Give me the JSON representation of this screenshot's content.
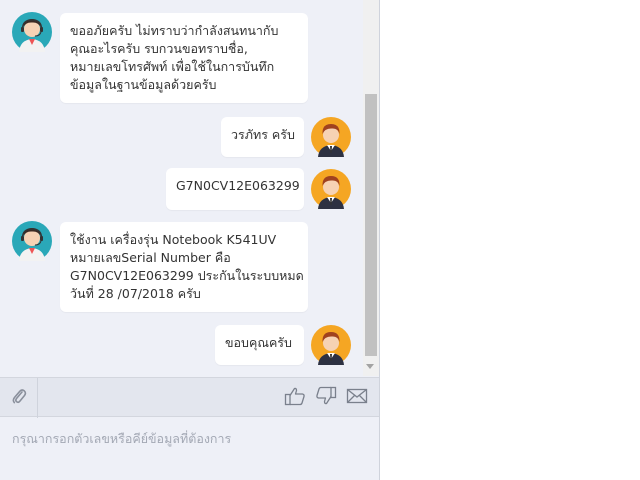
{
  "messages": [
    {
      "from": "agent",
      "lines": [
        "ขออภัยครับ ไม่ทราบว่ากำลังสนทนากับ",
        "คุณอะไรครับ รบกวนขอทราบชื่อ,",
        "หมายเลขโทรศัพท์ เพื่อใช้ในการบันทึก",
        "ข้อมูลในฐานข้อมูลด้วยครับ"
      ]
    },
    {
      "from": "user",
      "lines": [
        "วรภัทร ครับ"
      ]
    },
    {
      "from": "user",
      "lines": [
        "G7N0CV12E063299"
      ]
    },
    {
      "from": "agent",
      "lines": [
        "ใช้งาน เครื่องรุ่น Notebook K541UV",
        "หมายเลขSerial Number คือ",
        "G7N0CV12E063299 ประกันในระบบหมด",
        "วันที่ 28 /07/2018 ครับ"
      ]
    },
    {
      "from": "user",
      "lines": [
        "ขอบคุณครับ"
      ]
    }
  ],
  "input": {
    "placeholder": "กรุณากรอกตัวเลขหรือคีย์ข้อมูลที่ต้องการ"
  },
  "toolbar": {
    "icons": [
      "paperclip-icon",
      "thumbs-up-icon",
      "thumbs-down-icon",
      "envelope-icon"
    ]
  },
  "colors": {
    "panel_bg": "#eef0f7",
    "bubble_bg": "#ffffff",
    "agent_avatar_bg": "#2aa8b8",
    "user_avatar_bg": "#f5a623"
  }
}
